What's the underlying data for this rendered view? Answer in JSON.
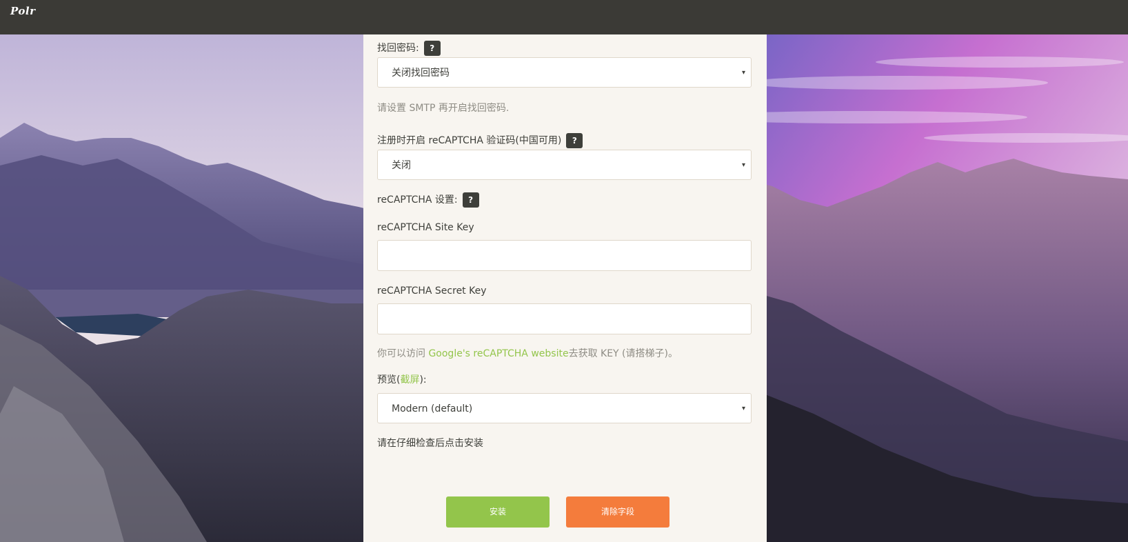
{
  "navbar": {
    "brand": "Polr"
  },
  "form": {
    "password_recovery": {
      "label": "找回密码:",
      "help": "?",
      "selected": "关闭找回密码",
      "hint": "请设置 SMTP 再开启找回密码."
    },
    "recaptcha_signup": {
      "label": "注册时开启 reCAPTCHA 验证码(中国可用)",
      "help": "?",
      "selected": "关闭"
    },
    "recaptcha_settings": {
      "label": "reCAPTCHA 设置:",
      "help": "?"
    },
    "site_key": {
      "label": "reCAPTCHA Site Key",
      "value": ""
    },
    "secret_key": {
      "label": "reCAPTCHA Secret Key",
      "value": ""
    },
    "recaptcha_hint": {
      "prefix": "你可以访问 ",
      "link": "Google's reCAPTCHA website",
      "suffix": "去获取 KEY (请搭梯子)。"
    },
    "theme": {
      "label_prefix": "预览(",
      "label_link": "截屏",
      "label_suffix": "):",
      "selected": "Modern (default)"
    },
    "confirm_text": "请在仔细检查后点击安装",
    "buttons": {
      "install": "安装",
      "clear": "清除字段"
    }
  },
  "icons": {
    "dropdown": "▾"
  },
  "colors": {
    "navbar": "#3b3a36",
    "panel": "#f8f5f0",
    "primary": "#93c54b",
    "warning": "#f47c3c",
    "help_bg": "#3e3f3a"
  }
}
